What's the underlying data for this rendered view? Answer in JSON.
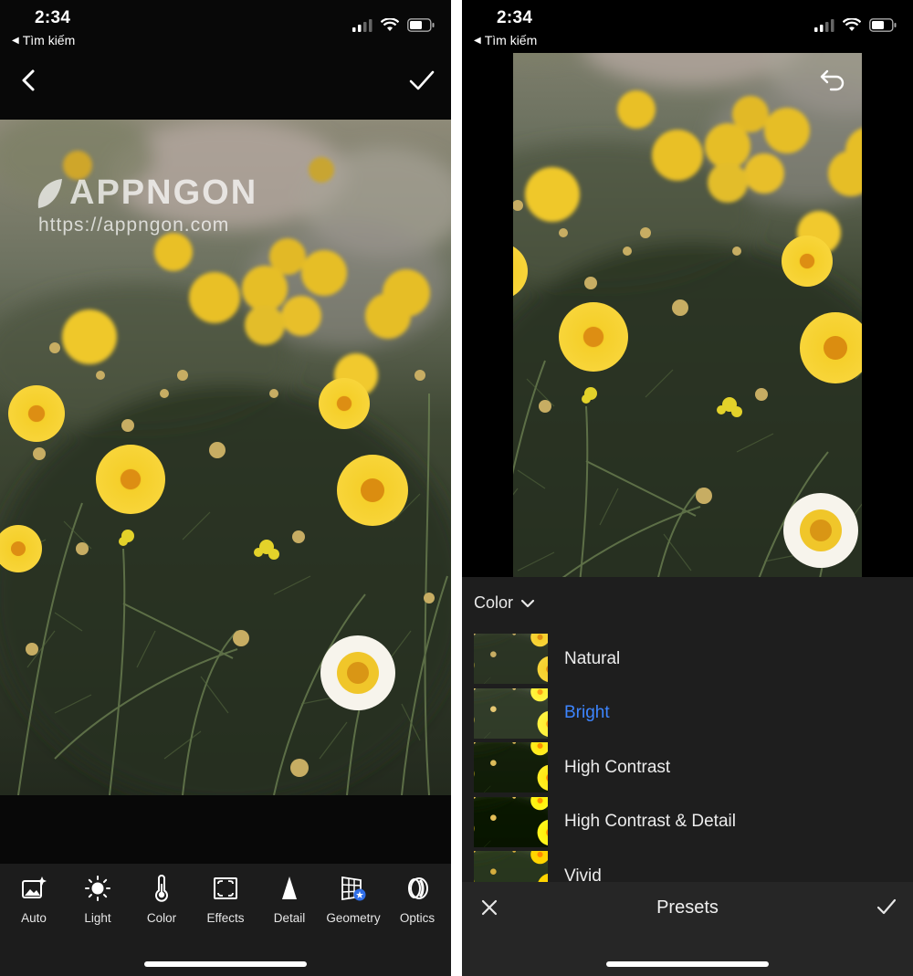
{
  "status": {
    "time": "2:34",
    "back_app": "Tìm kiếm"
  },
  "watermark": {
    "brand": "APPNGON",
    "url": "https://appngon.com"
  },
  "toolbar": {
    "items": [
      {
        "label": "Auto",
        "icon": "auto-image-icon"
      },
      {
        "label": "Light",
        "icon": "sun-icon"
      },
      {
        "label": "Color",
        "icon": "thermometer-icon"
      },
      {
        "label": "Effects",
        "icon": "vignette-icon"
      },
      {
        "label": "Detail",
        "icon": "triangle-icon"
      },
      {
        "label": "Geometry",
        "icon": "grid-badge-icon"
      },
      {
        "label": "Optics",
        "icon": "lens-icon"
      }
    ]
  },
  "presets_panel": {
    "category": "Color",
    "items": [
      {
        "name": "Natural"
      },
      {
        "name": "Bright"
      },
      {
        "name": "High Contrast"
      },
      {
        "name": "High Contrast & Detail"
      },
      {
        "name": "Vivid"
      }
    ],
    "selected": "Bright",
    "title": "Presets"
  },
  "colors": {
    "accent": "#3d85ff",
    "flower": "#f3c81f",
    "foliage": "#2c3425"
  }
}
